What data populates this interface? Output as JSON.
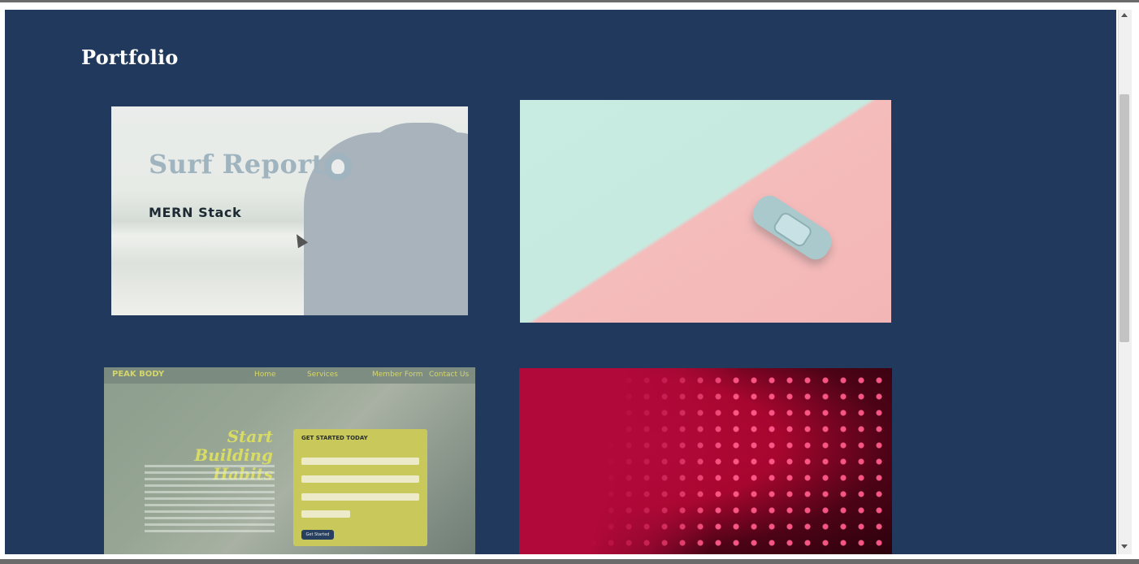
{
  "page": {
    "title": "Portfolio"
  },
  "cards": [
    {
      "project_title": "Surf Report",
      "stack": "MERN Stack",
      "icon": "github-icon"
    },
    {
      "icon": "car-image"
    },
    {
      "brand": "PEAK BODY",
      "nav": [
        "Home",
        "Services",
        "Member Form",
        "Contact Us"
      ],
      "heading": "Start Building Habits",
      "form_title": "GET STARTED TODAY",
      "button": "Get Started"
    },
    {
      "icon": "led-lights-image"
    }
  ],
  "colors": {
    "background": "#20395c",
    "title": "#ffffff"
  }
}
